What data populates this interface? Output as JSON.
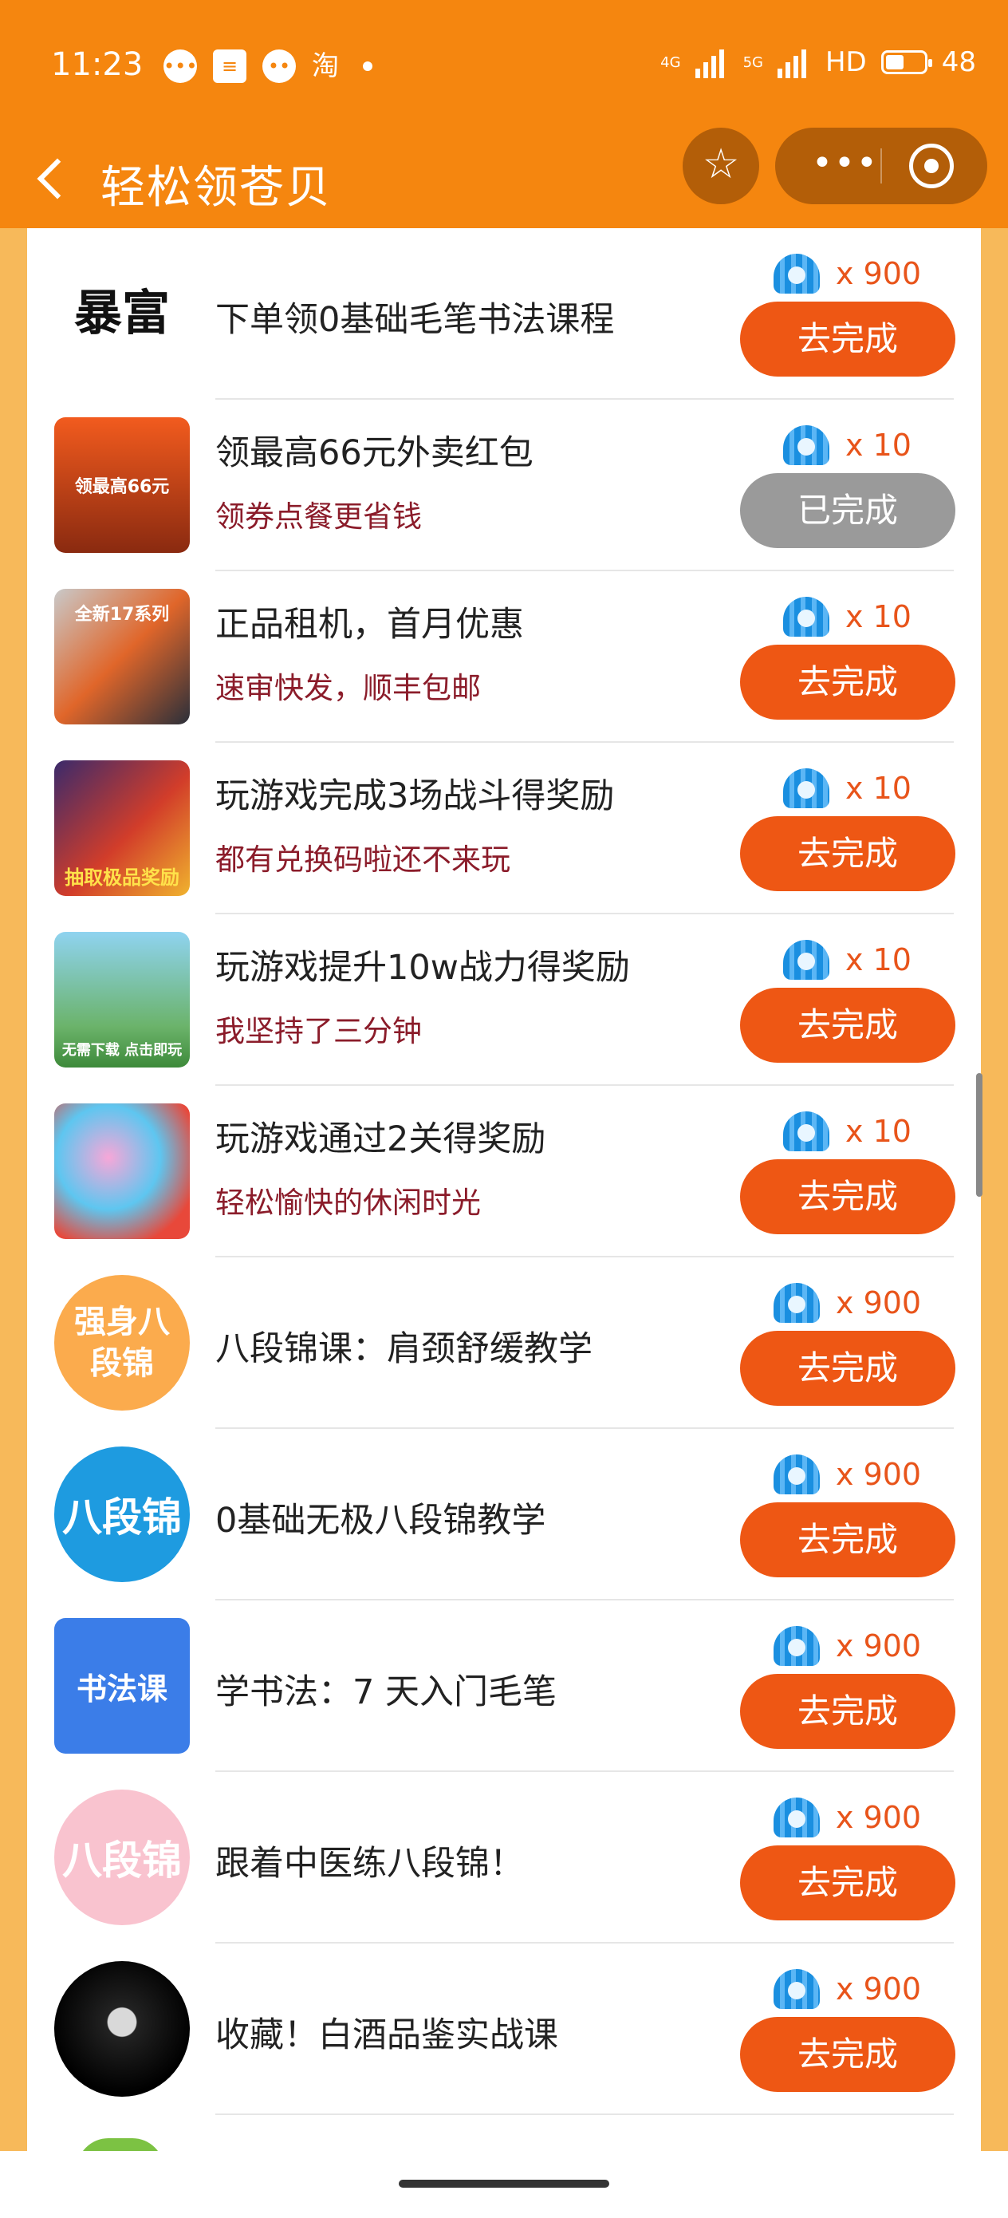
{
  "status_bar": {
    "time": "11:23",
    "net1": "4G",
    "net2": "5G",
    "hd": "HD",
    "battery": "48",
    "icons": [
      "message-icon",
      "list-icon",
      "chat-icon",
      "taobao-icon"
    ],
    "taobao": "淘"
  },
  "header": {
    "title": "轻松领苍贝",
    "more": "•••"
  },
  "colors": {
    "accent": "#f5860f",
    "button": "#ee5714",
    "done": "#9a9a9a",
    "subtitle": "#8b1c2a"
  },
  "tasks": [
    {
      "title": "下单领0基础毛笔书法课程",
      "subtitle": "",
      "reward": "x 900",
      "button": "去完成",
      "done": false,
      "thumb": "暴富"
    },
    {
      "title": "领最高66元外卖红包",
      "subtitle": "领券点餐更省钱",
      "reward": "x 10",
      "button": "已完成",
      "done": true,
      "thumb": "领最高66元"
    },
    {
      "title": "正品租机，首月优惠",
      "subtitle": "速审快发，顺丰包邮",
      "reward": "x 10",
      "button": "去完成",
      "done": false,
      "thumb": "全新17系列"
    },
    {
      "title": "玩游戏完成3场战斗得奖励",
      "subtitle": "都有兑换码啦还不来玩",
      "reward": "x 10",
      "button": "去完成",
      "done": false,
      "thumb": "抽取极品奖励"
    },
    {
      "title": "玩游戏提升10w战力得奖励",
      "subtitle": "我坚持了三分钟",
      "reward": "x 10",
      "button": "去完成",
      "done": false,
      "thumb": "无需下载 点击即玩"
    },
    {
      "title": "玩游戏通过2关得奖励",
      "subtitle": "轻松愉快的休闲时光",
      "reward": "x 10",
      "button": "去完成",
      "done": false,
      "thumb": ""
    },
    {
      "title": "八段锦课：肩颈舒缓教学",
      "subtitle": "",
      "reward": "x 900",
      "button": "去完成",
      "done": false,
      "thumb": "强身八段锦"
    },
    {
      "title": "0基础无极八段锦教学",
      "subtitle": "",
      "reward": "x 900",
      "button": "去完成",
      "done": false,
      "thumb": "八段锦"
    },
    {
      "title": "学书法：7 天入门毛笔",
      "subtitle": "",
      "reward": "x 900",
      "button": "去完成",
      "done": false,
      "thumb": "书法课"
    },
    {
      "title": "跟着中医练八段锦！",
      "subtitle": "",
      "reward": "x 900",
      "button": "去完成",
      "done": false,
      "thumb": "八段锦"
    },
    {
      "title": "收藏！白酒品鉴实战课",
      "subtitle": "",
      "reward": "x 900",
      "button": "去完成",
      "done": false,
      "thumb": ""
    }
  ]
}
